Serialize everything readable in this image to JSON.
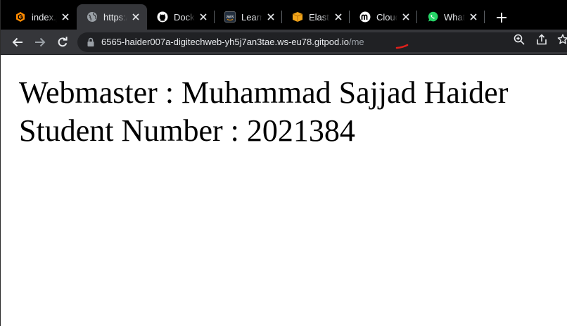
{
  "tabs": [
    {
      "title": "index.js",
      "icon": "gitpod-icon"
    },
    {
      "title": "https://",
      "icon": "globe-icon"
    },
    {
      "title": "Docker",
      "icon": "github-icon"
    },
    {
      "title": "Learner",
      "icon": "aws-icon"
    },
    {
      "title": "Elastic",
      "icon": "box-icon"
    },
    {
      "title": "Cloud",
      "icon": "moodle-icon"
    },
    {
      "title": "WhatsApp",
      "icon": "whatsapp-icon"
    }
  ],
  "toolbar": {
    "url_main": "6565-haider007a-digitechweb-yh5j7an3tae.ws-eu78.gitpod.io",
    "url_path": "/me"
  },
  "aws_badge": "aws",
  "page": {
    "line1": "Webmaster : Muhammad Sajjad Haider",
    "line2": "Student Number : 2021384"
  },
  "colors": {
    "tabstrip": "#000000",
    "toolbar": "#35363a",
    "omnibox": "#202124",
    "gitpod": "#ff8a00",
    "whatsapp": "#25d366",
    "annotation": "#e0201b"
  }
}
